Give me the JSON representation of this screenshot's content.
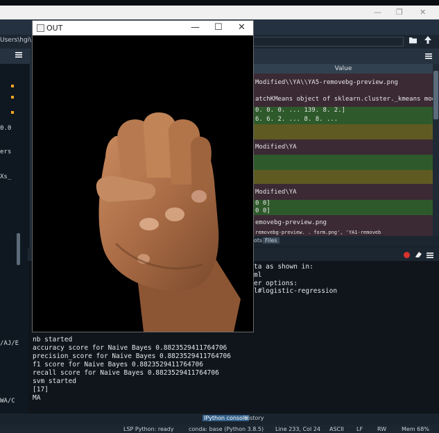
{
  "out_window": {
    "title": "OUT",
    "minimize": "—",
    "maximize": "☐",
    "close": "✕"
  },
  "ide": {
    "window_controls": {
      "minimize": "—",
      "maximize": "❐",
      "close": "✕"
    },
    "path_bar": "Users\\hgi\\Desl",
    "editor_fragments": [
      "0.0",
      "ers",
      "Xs_",
      "/AJ/E",
      "WA/C"
    ],
    "variable_explorer": {
      "column_header": "Value",
      "rows": [
        "Modified\\\\YA\\\\YA5-removebg-preview.png",
        "atchKMeans object of sklearn.cluster._kmeans module",
        "  0.  0.  0. ... 139.  8.  2.]",
        "  6.  6.  2. ...  8.  8. ...",
        "",
        "Modified\\YA",
        "",
        "",
        "Modified\\YA",
        "0 0]",
        "0 0]",
        "emovebg-preview.png",
        "  removebg-preview. .  form.png', 'YA1-removeb"
      ],
      "tabs": [
        "ots",
        "Files"
      ]
    },
    "console": {
      "right_lines": [
        "ta as shown in:",
        "ml",
        "er options:",
        "l#logistic-regression"
      ],
      "lines": [
        "nb started",
        "accuracy score for  Naive Bayes 0.8823529411764706",
        "precision_score for  Naive Bayes 0.8823529411764706",
        "f1 score for  Naive Bayes 0.8823529411764706",
        "recall score for  Naive Bayes 0.8823529411764706",
        "svm started",
        "[17]",
        "MA"
      ]
    },
    "bottom_tabs": [
      "IPython console",
      "History"
    ],
    "status": {
      "lsp": "LSP Python: ready",
      "conda": "conda: base (Python 3.8.5)",
      "position": "Line 233, Col 24",
      "encoding": "ASCII",
      "eol": "LF",
      "rw": "RW",
      "mem": "Mem 68%"
    }
  },
  "colors": {
    "ide_bg": "#19232d",
    "row_maroon": "#3b2a33",
    "row_green": "#2e5a2b",
    "row_olive": "#5f5a22",
    "accent_blue": "#33608a"
  },
  "icons": {
    "folder": "folder-open-icon",
    "up_arrow": "up-arrow-icon",
    "menu": "menu-icon",
    "eraser": "eraser-icon",
    "stop": "stop-icon"
  }
}
